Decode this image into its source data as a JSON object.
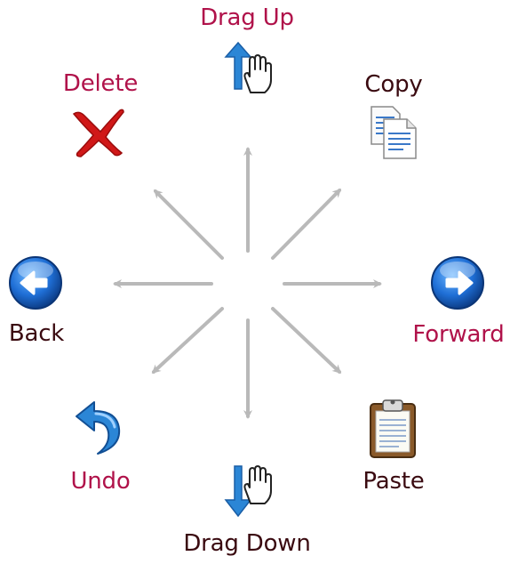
{
  "gestures": {
    "drag_up": {
      "label": "Drag Up",
      "icon": "drag-up-hand-icon",
      "color": "#b0124a"
    },
    "delete": {
      "label": "Delete",
      "icon": "red-x-icon",
      "color": "#b0124a"
    },
    "copy": {
      "label": "Copy",
      "icon": "copy-pages-icon",
      "color": "#3a0a10"
    },
    "back": {
      "label": "Back",
      "icon": "back-arrow-icon",
      "color": "#3a0a10"
    },
    "forward": {
      "label": "Forward",
      "icon": "forward-arrow-icon",
      "color": "#b0124a"
    },
    "undo": {
      "label": "Undo",
      "icon": "undo-arrow-icon",
      "color": "#b0124a"
    },
    "paste": {
      "label": "Paste",
      "icon": "clipboard-icon",
      "color": "#3a0a10"
    },
    "drag_down": {
      "label": "Drag Down",
      "icon": "drag-down-hand-icon",
      "color": "#3a0a10"
    }
  },
  "colors": {
    "arrow": "#b9b9b9",
    "accent_blue": "#1e73c8",
    "delete_red": "#d01818"
  }
}
